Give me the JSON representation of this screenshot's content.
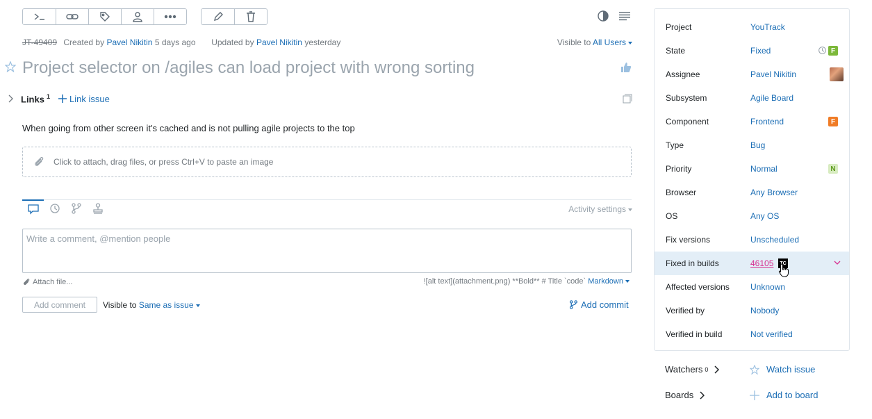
{
  "toolbar": {
    "command_icon": "terminal-icon",
    "link_icon": "link-icon",
    "tag_icon": "tag-icon",
    "user_icon": "user-icon",
    "more_icon": "more-icon",
    "edit_icon": "pencil-icon",
    "delete_icon": "trash-icon"
  },
  "meta": {
    "issue_id": "JT-49409",
    "created_prefix": "Created by",
    "created_by": "Pavel Nikitin",
    "created_when": "5 days ago",
    "updated_prefix": "Updated by",
    "updated_by": "Pavel Nikitin",
    "updated_when": "yesterday",
    "visible_prefix": "Visible to",
    "visible_value": "All Users"
  },
  "issue": {
    "title": "Project selector on /agiles can load project with wrong sorting",
    "description": "When going from other screen it's cached and is not pulling agile projects to the top"
  },
  "links": {
    "label": "Links",
    "count": "1",
    "link_issue": "Link issue"
  },
  "attachments": {
    "dropzone_text": "Click to attach, drag files, or press Ctrl+V to paste an image"
  },
  "activity": {
    "settings_label": "Activity settings"
  },
  "comment": {
    "placeholder": "Write a comment, @mention people",
    "attach_file": "Attach file...",
    "markdown_hint": "![alt text](attachment.png) **Bold** # Title `code`",
    "markdown_label": "Markdown",
    "add_comment": "Add comment",
    "visible_prefix": "Visible to",
    "visible_value": "Same as issue",
    "add_commit": "Add commit"
  },
  "fields": [
    {
      "name": "Project",
      "value": "YouTrack"
    },
    {
      "name": "State",
      "value": "Fixed",
      "badge": "F",
      "badge_color": "#7cb83a"
    },
    {
      "name": "Assignee",
      "value": "Pavel Nikitin"
    },
    {
      "name": "Subsystem",
      "value": "Agile Board"
    },
    {
      "name": "Component",
      "value": "Frontend",
      "badge": "F",
      "badge_color": "#f07c26"
    },
    {
      "name": "Type",
      "value": "Bug"
    },
    {
      "name": "Priority",
      "value": "Normal",
      "badge": "N",
      "badge_color": "#d8ecc1"
    },
    {
      "name": "Browser",
      "value": "Any Browser"
    },
    {
      "name": "OS",
      "value": "Any OS"
    },
    {
      "name": "Fix versions",
      "value": "Unscheduled"
    },
    {
      "name": "Fixed in builds",
      "value": "46105",
      "badge": "TC"
    },
    {
      "name": "Affected versions",
      "value": "Unknown"
    },
    {
      "name": "Verified by",
      "value": "Nobody"
    },
    {
      "name": "Verified in build",
      "value": "Not verified"
    }
  ],
  "sidebar": {
    "watchers_label": "Watchers",
    "watchers_count": "0",
    "watch_issue": "Watch issue",
    "boards_label": "Boards",
    "add_to_board": "Add to board"
  }
}
